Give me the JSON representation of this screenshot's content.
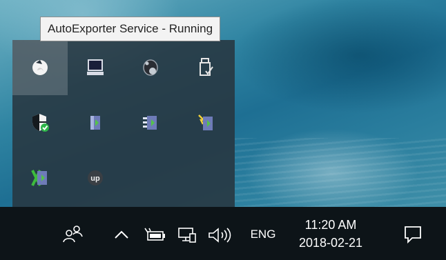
{
  "tooltip": {
    "text": "AutoExporter Service - Running"
  },
  "tray_overflow": {
    "icons": [
      {
        "name": "autoexporter-service-icon",
        "selected": true
      },
      {
        "name": "touchpad-icon"
      },
      {
        "name": "speaker-icon"
      },
      {
        "name": "usb-drive-icon"
      },
      {
        "name": "windows-defender-shield-icon"
      },
      {
        "name": "app-icon"
      },
      {
        "name": "app-icon"
      },
      {
        "name": "app-icon"
      },
      {
        "name": "app-icon"
      },
      {
        "name": "upwork-icon",
        "text": "up"
      }
    ]
  },
  "taskbar": {
    "language": "ENG",
    "time": "11:20 AM",
    "date": "2018-02-21"
  },
  "colors": {
    "taskbar_bg": "#0d1418",
    "flyout_bg": "#28343e",
    "tooltip_bg": "#f3f3f3",
    "defender_green": "#2fb54a"
  }
}
